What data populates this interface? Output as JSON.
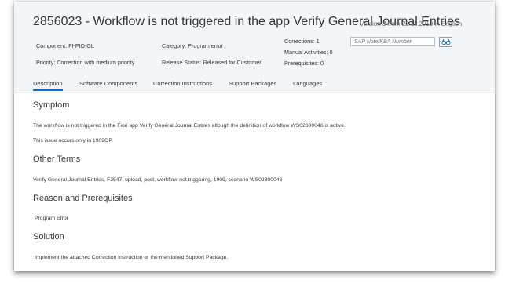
{
  "header": {
    "title": "2856023 - Workflow is not triggered in the app Verify General Journal Entries",
    "version_info": "Version 3 from 22.11.2019 in English",
    "meta": {
      "component": "Component: FI-FIO-GL",
      "priority": "Priority: Correction with medium priority",
      "category": "Category: Program error",
      "release_status": "Release Status: Released for Customer",
      "corrections": "Corrections: 1",
      "manual_activities": "Manual Activities: 0",
      "prerequisites": "Prerequisites: 0"
    },
    "search": {
      "placeholder": "SAP Note/KBA Number"
    }
  },
  "tabs": [
    {
      "label": "Description",
      "active": true
    },
    {
      "label": "Software Components",
      "active": false
    },
    {
      "label": "Correction Instructions",
      "active": false
    },
    {
      "label": "Support Packages",
      "active": false
    },
    {
      "label": "Languages",
      "active": false
    }
  ],
  "content": {
    "symptom": {
      "heading": "Symptom",
      "line1": "The workflow is not triggered in the Fiori app Verify General Journal Entries altough the definition of workflow WS02800046 is active.",
      "line2": "This issue occurs only in 1909OP."
    },
    "other_terms": {
      "heading": "Other Terms",
      "text": "Verify General Journal Entries, F2547, upload, post, workflow not triggering, 1909, scenario WS02800046"
    },
    "reason": {
      "heading": "Reason and Prerequisites",
      "text": "Program Error"
    },
    "solution": {
      "heading": "Solution",
      "text": "Implement the attached Correction Instruction or the mentioned Support Package."
    }
  },
  "colors": {
    "header_bg": "#f2f6f9",
    "text": "#32363a",
    "tab_underline": "#0a6ed1"
  },
  "icons": {
    "search_button": "binoculars-icon"
  }
}
